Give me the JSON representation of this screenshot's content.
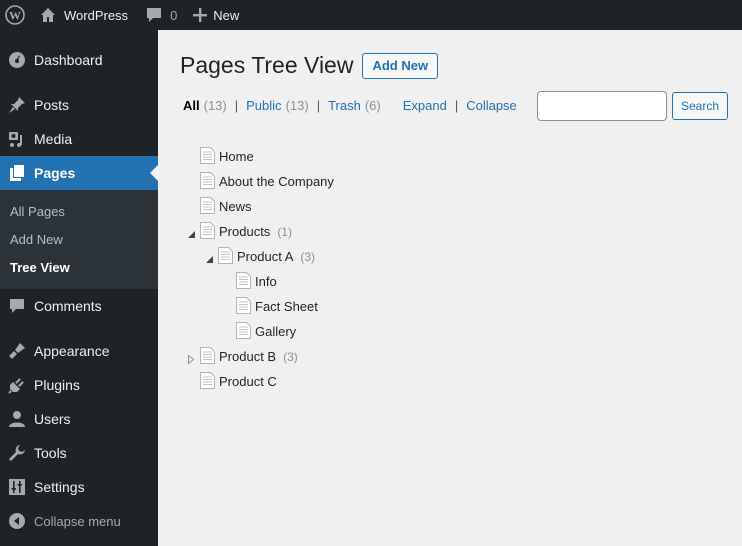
{
  "adminbar": {
    "site_name": "WordPress",
    "comments_count": "0",
    "new_label": "New"
  },
  "sidebar": {
    "items": [
      {
        "label": "Dashboard",
        "icon": "dashboard-icon"
      },
      {
        "label": "Posts",
        "icon": "pin-icon"
      },
      {
        "label": "Media",
        "icon": "media-icon"
      },
      {
        "label": "Pages",
        "icon": "pages-icon",
        "current": true
      },
      {
        "label": "Comments",
        "icon": "comment-icon"
      },
      {
        "label": "Appearance",
        "icon": "brush-icon"
      },
      {
        "label": "Plugins",
        "icon": "plugin-icon"
      },
      {
        "label": "Users",
        "icon": "user-icon"
      },
      {
        "label": "Tools",
        "icon": "wrench-icon"
      },
      {
        "label": "Settings",
        "icon": "settings-icon"
      }
    ],
    "submenu": [
      {
        "label": "All Pages"
      },
      {
        "label": "Add New"
      },
      {
        "label": "Tree View",
        "active": true
      }
    ],
    "collapse_label": "Collapse menu"
  },
  "main": {
    "title": "Pages Tree View",
    "add_new_label": "Add New",
    "filters": {
      "all_label": "All",
      "all_count": "(13)",
      "public_label": "Public",
      "public_count": "(13)",
      "trash_label": "Trash",
      "trash_count": "(6)",
      "expand_label": "Expand",
      "collapse_label": "Collapse",
      "separator": "|"
    },
    "search": {
      "value": "",
      "button_label": "Search"
    },
    "accent_color": "#2271b1"
  },
  "tree": [
    {
      "title": "Home",
      "level": 0,
      "count": "",
      "toggle": "none"
    },
    {
      "title": "About the Company",
      "level": 0,
      "count": "",
      "toggle": "none"
    },
    {
      "title": "News",
      "level": 0,
      "count": "",
      "toggle": "none"
    },
    {
      "title": "Products",
      "level": 0,
      "count": "(1)",
      "toggle": "expanded"
    },
    {
      "title": "Product A",
      "level": 1,
      "count": "(3)",
      "toggle": "expanded"
    },
    {
      "title": "Info",
      "level": 2,
      "count": "",
      "toggle": "none"
    },
    {
      "title": "Fact Sheet",
      "level": 2,
      "count": "",
      "toggle": "none"
    },
    {
      "title": "Gallery",
      "level": 2,
      "count": "",
      "toggle": "none"
    },
    {
      "title": "Product B",
      "level": 0,
      "count": "(3)",
      "toggle": "collapsed"
    },
    {
      "title": "Product C",
      "level": 0,
      "count": "",
      "toggle": "none"
    }
  ]
}
